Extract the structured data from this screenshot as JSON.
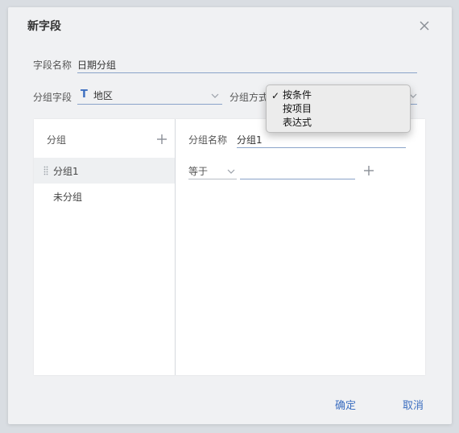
{
  "dialog": {
    "title": "新字段",
    "close_icon": "close-icon"
  },
  "form": {
    "field_name_label": "字段名称",
    "field_name_value": "日期分组",
    "group_field_label": "分组字段",
    "group_field_type_icon": "T",
    "group_field_value": "地区",
    "group_method_label": "分组方式"
  },
  "group_method_dropdown": {
    "options": [
      "按条件",
      "按项目",
      "表达式"
    ],
    "selected": "按条件",
    "check_mark": "✓"
  },
  "groups_panel": {
    "header": "分组",
    "items": [
      {
        "label": "分组1",
        "selected": true
      },
      {
        "label": "未分组",
        "selected": false
      }
    ]
  },
  "group_detail": {
    "name_label": "分组名称",
    "name_value": "分组1",
    "condition_operator": "等于",
    "condition_value": ""
  },
  "footer": {
    "confirm": "确定",
    "cancel": "取消"
  },
  "colors": {
    "accent": "#3d6fc0",
    "dialog_bg": "#f0f1f3",
    "panel_bg": "#ffffff"
  }
}
